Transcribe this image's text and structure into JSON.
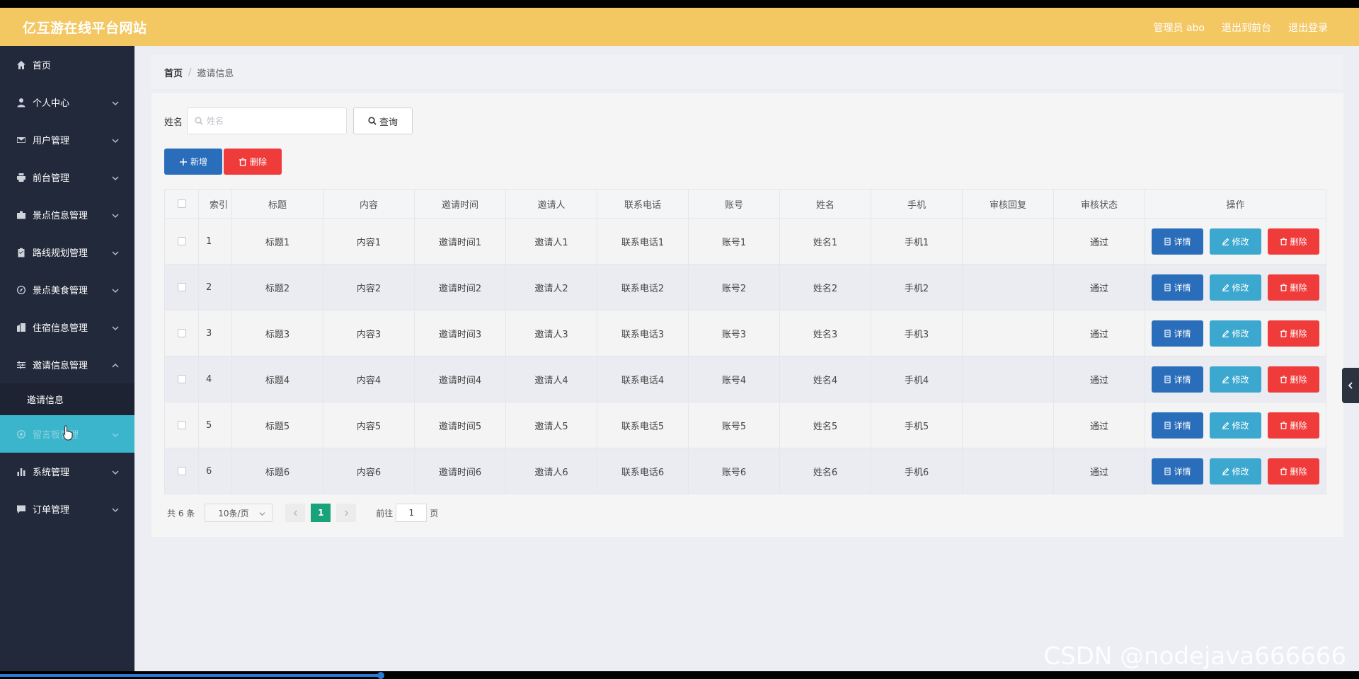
{
  "header": {
    "site_title": "亿互游在线平台网站",
    "links": [
      "管理员 abo",
      "退出到前台",
      "退出登录"
    ]
  },
  "sidebar": {
    "items": [
      {
        "label": "首页",
        "icon": "home-icon",
        "has_chevron": false
      },
      {
        "label": "个人中心",
        "icon": "user-icon",
        "has_chevron": true
      },
      {
        "label": "用户管理",
        "icon": "mail-icon",
        "has_chevron": true
      },
      {
        "label": "前台管理",
        "icon": "printer-icon",
        "has_chevron": true
      },
      {
        "label": "景点信息管理",
        "icon": "briefcase-icon",
        "has_chevron": true
      },
      {
        "label": "路线规划管理",
        "icon": "clipboard-icon",
        "has_chevron": true
      },
      {
        "label": "景点美食管理",
        "icon": "compass-icon",
        "has_chevron": true
      },
      {
        "label": "住宿信息管理",
        "icon": "building-icon",
        "has_chevron": true
      },
      {
        "label": "邀请信息管理",
        "icon": "sliders-icon",
        "has_chevron": true,
        "expanded": true
      },
      {
        "label": "留言板管理",
        "icon": "chat-icon",
        "has_chevron": true,
        "active": true
      },
      {
        "label": "系统管理",
        "icon": "chart-icon",
        "has_chevron": true
      },
      {
        "label": "订单管理",
        "icon": "message-icon",
        "has_chevron": true
      }
    ],
    "submenu": {
      "parent_index": 8,
      "label": "邀请信息"
    }
  },
  "breadcrumb": {
    "home": "首页",
    "separator": "/",
    "current": "邀请信息"
  },
  "search": {
    "label": "姓名",
    "placeholder": "姓名",
    "value": "",
    "button": "查询"
  },
  "actions": {
    "add": "新增",
    "delete": "删除"
  },
  "table": {
    "columns": [
      "索引",
      "标题",
      "内容",
      "邀请时间",
      "邀请人",
      "联系电话",
      "账号",
      "姓名",
      "手机",
      "审核回复",
      "审核状态",
      "操作"
    ],
    "rows": [
      [
        "1",
        "标题1",
        "内容1",
        "邀请时间1",
        "邀请人1",
        "联系电话1",
        "账号1",
        "姓名1",
        "手机1",
        "",
        "通过"
      ],
      [
        "2",
        "标题2",
        "内容2",
        "邀请时间2",
        "邀请人2",
        "联系电话2",
        "账号2",
        "姓名2",
        "手机2",
        "",
        "通过"
      ],
      [
        "3",
        "标题3",
        "内容3",
        "邀请时间3",
        "邀请人3",
        "联系电话3",
        "账号3",
        "姓名3",
        "手机3",
        "",
        "通过"
      ],
      [
        "4",
        "标题4",
        "内容4",
        "邀请时间4",
        "邀请人4",
        "联系电话4",
        "账号4",
        "姓名4",
        "手机4",
        "",
        "通过"
      ],
      [
        "5",
        "标题5",
        "内容5",
        "邀请时间5",
        "邀请人5",
        "联系电话5",
        "账号5",
        "姓名5",
        "手机5",
        "",
        "通过"
      ],
      [
        "6",
        "标题6",
        "内容6",
        "邀请时间6",
        "邀请人6",
        "联系电话6",
        "账号6",
        "姓名6",
        "手机6",
        "",
        "通过"
      ]
    ],
    "row_actions": {
      "detail": "详情",
      "edit": "修改",
      "delete": "删除"
    }
  },
  "pagination": {
    "total": "共 6 条",
    "page_size": "10条/页",
    "current_page": "1",
    "goto_prefix": "前往",
    "goto_value": "1",
    "goto_suffix": "页"
  },
  "watermark": "CSDN @nodejava666666",
  "colors": {
    "header": "#f3c762",
    "sidebar": "#22293a",
    "active_menu": "#3ab5cc",
    "primary": "#2a6ebb",
    "info": "#3ca8cf",
    "danger": "#f03b3b",
    "pager_active": "#1aa37b"
  },
  "video_progress": 0.28
}
